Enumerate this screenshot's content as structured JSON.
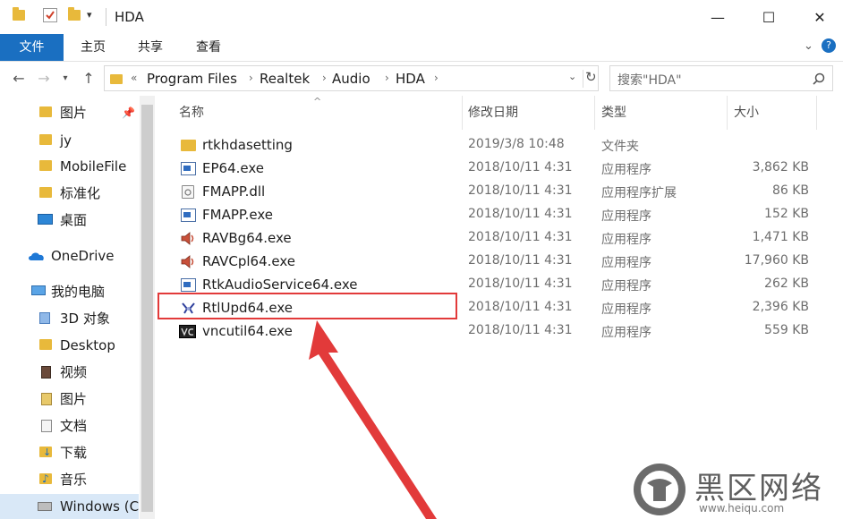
{
  "window": {
    "title": "HDA",
    "controls": {
      "minimize": "—",
      "maximize": "☐",
      "close": "✕"
    }
  },
  "ribbon": {
    "tabs": [
      "文件",
      "主页",
      "共享",
      "查看"
    ]
  },
  "address": {
    "prefix": "«",
    "crumbs": [
      "Program Files",
      "Realtek",
      "Audio",
      "HDA"
    ],
    "search_placeholder": "搜索\"HDA\""
  },
  "sidebar": {
    "items": [
      {
        "label": "图片",
        "icon": "pictures-folder-icon",
        "pinned": true
      },
      {
        "label": "jy",
        "icon": "folder-icon"
      },
      {
        "label": "MobileFile",
        "icon": "folder-icon"
      },
      {
        "label": "标准化",
        "icon": "folder-icon"
      },
      {
        "label": "桌面",
        "icon": "desktop-icon"
      },
      {
        "label": "OneDrive",
        "icon": "onedrive-icon"
      },
      {
        "label": "我的电脑",
        "icon": "computer-icon"
      },
      {
        "label": "3D 对象",
        "icon": "3d-objects-icon"
      },
      {
        "label": "Desktop",
        "icon": "folder-icon"
      },
      {
        "label": "视频",
        "icon": "video-icon"
      },
      {
        "label": "图片",
        "icon": "pictures-icon"
      },
      {
        "label": "文档",
        "icon": "documents-icon"
      },
      {
        "label": "下载",
        "icon": "downloads-icon"
      },
      {
        "label": "音乐",
        "icon": "music-icon"
      },
      {
        "label": "Windows (C",
        "icon": "drive-icon"
      }
    ]
  },
  "columns": {
    "name": "名称",
    "date": "修改日期",
    "type": "类型",
    "size": "大小"
  },
  "files": [
    {
      "name": "rtkhdasetting",
      "date": "2019/3/8 10:48",
      "type": "文件夹",
      "size": "",
      "icon": "folder-icon"
    },
    {
      "name": "EP64.exe",
      "date": "2018/10/11 4:31",
      "type": "应用程序",
      "size": "3,862 KB",
      "icon": "exe-icon"
    },
    {
      "name": "FMAPP.dll",
      "date": "2018/10/11 4:31",
      "type": "应用程序扩展",
      "size": "86 KB",
      "icon": "dll-icon"
    },
    {
      "name": "FMAPP.exe",
      "date": "2018/10/11 4:31",
      "type": "应用程序",
      "size": "152 KB",
      "icon": "exe-icon"
    },
    {
      "name": "RAVBg64.exe",
      "date": "2018/10/11 4:31",
      "type": "应用程序",
      "size": "1,471 KB",
      "icon": "speaker-icon"
    },
    {
      "name": "RAVCpl64.exe",
      "date": "2018/10/11 4:31",
      "type": "应用程序",
      "size": "17,960 KB",
      "icon": "speaker-icon"
    },
    {
      "name": "RtkAudioService64.exe",
      "date": "2018/10/11 4:31",
      "type": "应用程序",
      "size": "262 KB",
      "icon": "exe-icon"
    },
    {
      "name": "RtlUpd64.exe",
      "date": "2018/10/11 4:31",
      "type": "应用程序",
      "size": "2,396 KB",
      "icon": "updater-icon"
    },
    {
      "name": "vncutil64.exe",
      "date": "2018/10/11 4:31",
      "type": "应用程序",
      "size": "559 KB",
      "icon": "vnc-icon"
    }
  ],
  "watermark": {
    "brand": "黑区网络",
    "site": "www.heiqu.com"
  }
}
